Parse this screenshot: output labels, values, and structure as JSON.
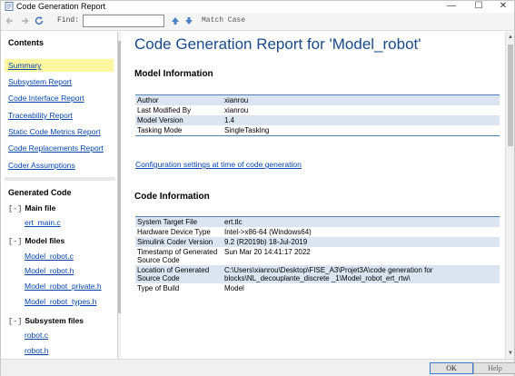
{
  "window": {
    "title": "Code Generation Report",
    "controls": {
      "minimize": "—",
      "maximize": "☐",
      "close": "✕"
    }
  },
  "toolbar": {
    "find_label": "Find:",
    "find_value": "",
    "match_case_label": "Match Case",
    "icons": [
      "back-icon",
      "forward-icon",
      "refresh-icon",
      "find-previous-icon",
      "find-next-icon"
    ]
  },
  "contents": {
    "heading": "Contents",
    "links": [
      {
        "label": "Summary",
        "active": true
      },
      {
        "label": "Subsystem Report"
      },
      {
        "label": "Code Interface Report"
      },
      {
        "label": "Traceability Report"
      },
      {
        "label": "Static Code Metrics Report"
      },
      {
        "label": "Code Replacements Report"
      },
      {
        "label": "Coder Assumptions"
      }
    ]
  },
  "generated_code": {
    "heading": "Generated Code",
    "groups": [
      {
        "collapse": "[-]",
        "label": "Main file",
        "files": [
          "ert_main.c"
        ]
      },
      {
        "collapse": "[-]",
        "label": "Model files",
        "files": [
          "Model_robot.c",
          "Model_robot.h",
          "Model_robot_private.h",
          "Model_robot_types.h"
        ]
      },
      {
        "collapse": "[-]",
        "label": "Subsystem files",
        "files": [
          "robot.c",
          "robot.h"
        ]
      }
    ]
  },
  "report": {
    "title": "Code Generation Report for 'Model_robot'",
    "model_info": {
      "heading": "Model Information",
      "rows": [
        {
          "key": "Author",
          "value": "xianrou"
        },
        {
          "key": "Last Modified By",
          "value": "xianrou"
        },
        {
          "key": "Model Version",
          "value": "1.4"
        },
        {
          "key": "Tasking Mode",
          "value": "SingleTasking"
        }
      ]
    },
    "config_link": "Configuration settings at time of code generation",
    "code_info": {
      "heading": "Code Information",
      "rows": [
        {
          "key": "System Target File",
          "value": "ert.tlc"
        },
        {
          "key": "Hardware Device Type",
          "value": "Intel->x86-64 (Windows64)"
        },
        {
          "key": "Simulink Coder Version",
          "value": "9.2 (R2019b) 18-Jul-2019"
        },
        {
          "key": "Timestamp of Generated Source Code",
          "value": "Sun Mar 20 14:41:17 2022"
        },
        {
          "key": "Location of Generated Source Code",
          "value": "C:\\Users\\xianrou\\Desktop\\FISE_A3\\Projet3A\\code generation for blocks\\NL_decouplante_discrete _1\\Model_robot_ert_rtw\\"
        },
        {
          "key": "Type of Build",
          "value": "Model"
        }
      ]
    }
  },
  "buttons": {
    "ok": "OK",
    "help": "Help"
  },
  "colors": {
    "title_blue": "#1a4a8a",
    "row_shade": "#dbe5f1",
    "link": "#0645ad",
    "active_highlight": "#fff6a0"
  }
}
